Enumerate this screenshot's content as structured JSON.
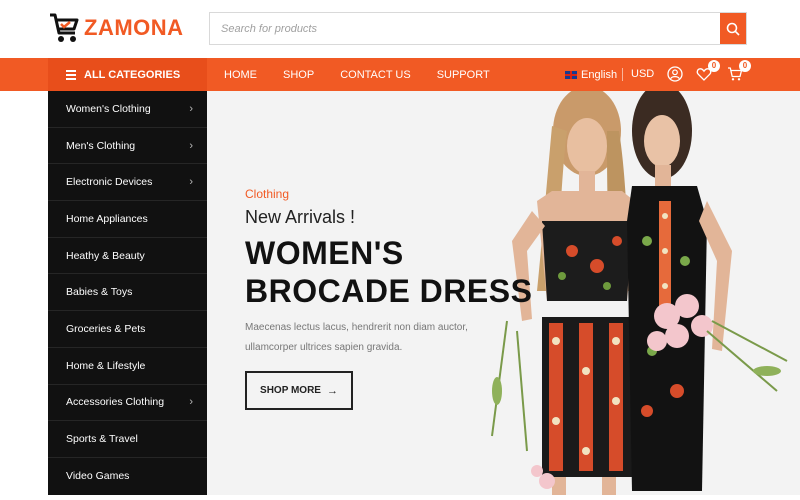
{
  "brand": {
    "name": "ZAMONA",
    "color": "#f15a24"
  },
  "search": {
    "placeholder": "Search for products"
  },
  "nav": {
    "all_categories": "ALL CATEGORIES",
    "menu": [
      "HOME",
      "SHOP",
      "CONTACT US",
      "SUPPORT"
    ],
    "language": "English",
    "currency": "USD",
    "wishlist_count": "0",
    "cart_count": "0"
  },
  "categories": [
    {
      "label": "Women's Clothing",
      "has_sub": true
    },
    {
      "label": "Men's Clothing",
      "has_sub": true
    },
    {
      "label": "Electronic Devices",
      "has_sub": true
    },
    {
      "label": "Home Appliances",
      "has_sub": false
    },
    {
      "label": "Heathy & Beauty",
      "has_sub": false
    },
    {
      "label": "Babies & Toys",
      "has_sub": false
    },
    {
      "label": "Groceries & Pets",
      "has_sub": false
    },
    {
      "label": "Home & Lifestyle",
      "has_sub": false
    },
    {
      "label": "Accessories Clothing",
      "has_sub": true
    },
    {
      "label": "Sports & Travel",
      "has_sub": false
    },
    {
      "label": "Video Games",
      "has_sub": false
    }
  ],
  "hero": {
    "category": "Clothing",
    "subtitle": "New Arrivals !",
    "headline_line1": "WOMEN'S",
    "headline_line2": "BROCADE DRESS",
    "desc_line1": "Maecenas lectus lacus, hendrerit non diam auctor,",
    "desc_line2": "ullamcorper ultrices sapien gravida.",
    "button": "SHOP MORE"
  },
  "icons": {
    "search": "search-icon",
    "cart": "shopping-cart-icon",
    "user": "user-icon",
    "wishlist": "heart-icon",
    "menu": "hamburger-icon"
  }
}
